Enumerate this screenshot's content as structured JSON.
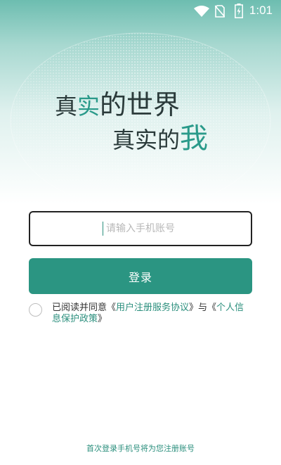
{
  "status_bar": {
    "time": "1:01",
    "icons": [
      "wifi-icon",
      "no-sim-icon",
      "battery-charging-icon"
    ]
  },
  "hero": {
    "line1_a": "真",
    "line1_b": "实",
    "line1_c": "的世界",
    "line2_a": "真实的",
    "line2_b": "我"
  },
  "login_form": {
    "phone_placeholder": "请输入手机账号",
    "phone_value": "",
    "login_label": "登录"
  },
  "agreement": {
    "checked": false,
    "prefix": "已阅读并同意《",
    "user_agreement": "用户注册服务协议",
    "middle": "》与《",
    "privacy_policy": "个人信息保护政策",
    "suffix": "》"
  },
  "footer": {
    "note": "首次登录手机号将为您注册账号"
  },
  "colors": {
    "accent": "#2b9582",
    "link": "#2b8f7d",
    "hero_top": "#6dbdb0"
  }
}
